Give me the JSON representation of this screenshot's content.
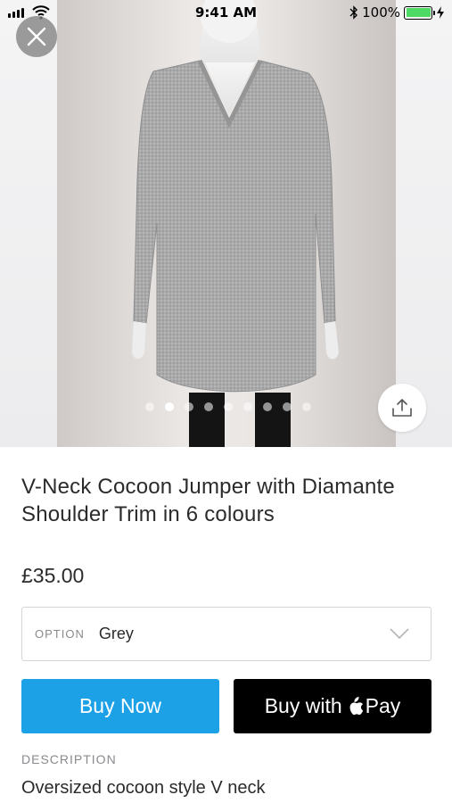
{
  "status_bar": {
    "time": "9:41 AM",
    "battery_text": "100%",
    "battery_level": 1.0,
    "icons": [
      "signal-icon",
      "wifi-icon",
      "bluetooth-icon",
      "battery-icon",
      "charging-icon"
    ]
  },
  "gallery": {
    "image_count": 9,
    "active_index": 1,
    "close_icon": "close-icon",
    "share_icon": "share-icon"
  },
  "product": {
    "title": "V-Neck Cocoon Jumper with Diamante Shoulder Trim in 6 colours",
    "price": "£35.00",
    "option_label": "OPTION",
    "option_value": "Grey"
  },
  "actions": {
    "buy_now_label": "Buy Now",
    "apple_pay_prefix": "Buy with",
    "apple_pay_suffix": "Pay"
  },
  "description": {
    "label": "DESCRIPTION",
    "text": "Oversized cocoon style V neck"
  },
  "colors": {
    "buy_now": "#1da1e6",
    "apple_pay": "#000000",
    "battery": "#4cd964",
    "text": "#2b2b2b",
    "muted": "#8a8a8e"
  }
}
